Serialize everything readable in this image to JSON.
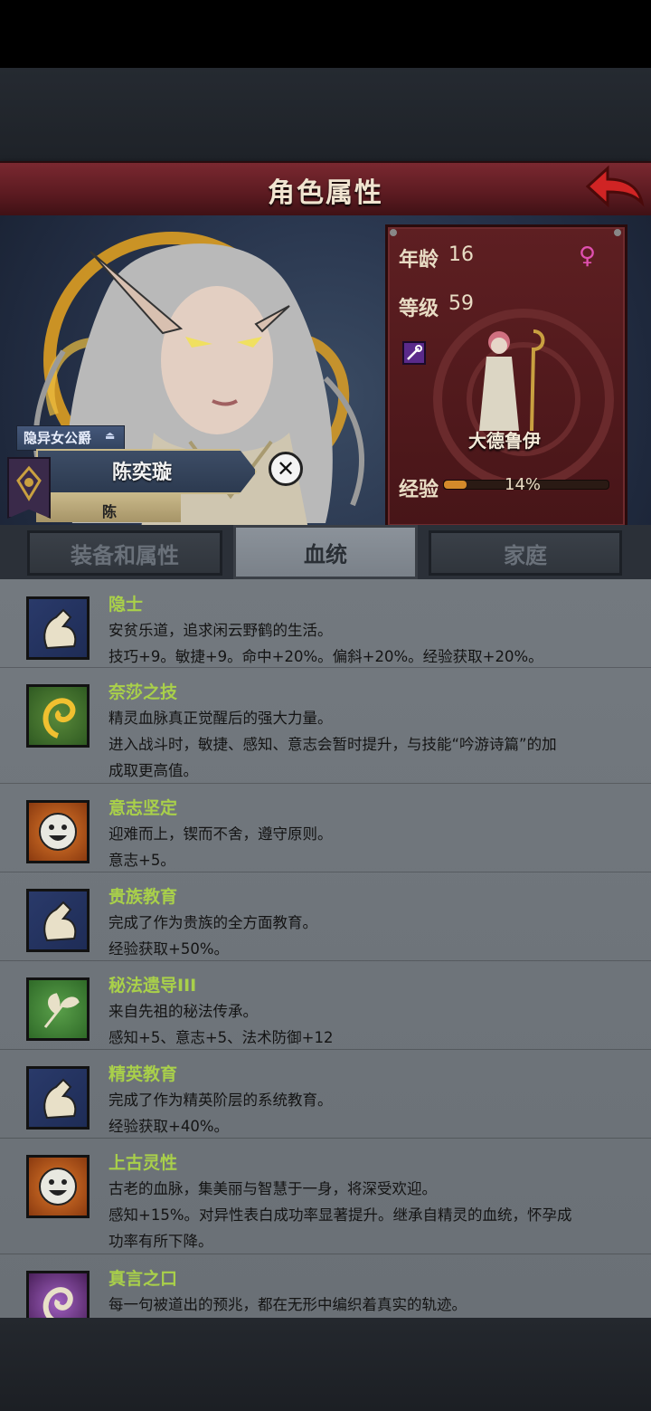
{
  "header": {
    "title": "角色属性"
  },
  "character": {
    "title_badge": "隐异女公爵",
    "name": "陈奕璇",
    "family": "陈",
    "age_label": "年龄",
    "age": "16",
    "level_label": "等级",
    "level": "59",
    "class_name": "大德鲁伊",
    "exp_label": "经验",
    "exp_percent": "14%",
    "exp_progress": 0.14
  },
  "tabs": [
    {
      "label": "装备和属性",
      "active": false
    },
    {
      "label": "血统",
      "active": true
    },
    {
      "label": "家庭",
      "active": false
    }
  ],
  "traits": [
    {
      "name": "隐士",
      "icon": "arm-icon",
      "lines": [
        "安贫乐道，追求闲云野鹤的生活。",
        "技巧+9。敏捷+9。命中+20%。偏斜+20%。经验获取+20%。"
      ]
    },
    {
      "name": "奈莎之技",
      "icon": "spiral-icon",
      "lines": [
        "精灵血脉真正觉醒后的强大力量。",
        "进入战斗时，敏捷、感知、意志会暂时提升，与技能“吟游诗篇”的加",
        "成取更高值。"
      ]
    },
    {
      "name": "意志坚定",
      "icon": "smile-icon",
      "lines": [
        "迎难而上，锲而不舍，遵守原则。",
        "意志+5。"
      ]
    },
    {
      "name": "贵族教育",
      "icon": "arm-icon",
      "lines": [
        "完成了作为贵族的全方面教育。",
        "经验获取+50%。"
      ]
    },
    {
      "name": "秘法遗导III",
      "icon": "leaf-icon",
      "lines": [
        "来自先祖的秘法传承。",
        "感知+5、意志+5、法术防御+12"
      ]
    },
    {
      "name": "精英教育",
      "icon": "arm-icon",
      "lines": [
        "完成了作为精英阶层的系统教育。",
        "经验获取+40%。"
      ]
    },
    {
      "name": "上古灵性",
      "icon": "smile-icon",
      "lines": [
        "古老的血脉，集美丽与智慧于一身，将深受欢迎。",
        "感知+15%。对异性表白成功率显著提升。继承自精灵的血统，怀孕成",
        "功率有所下降。"
      ]
    },
    {
      "name": "真言之口",
      "icon": "whirl-icon",
      "lines": [
        "每一句被道出的预兆，都在无形中编织着真实的轨迹。"
      ]
    }
  ]
}
